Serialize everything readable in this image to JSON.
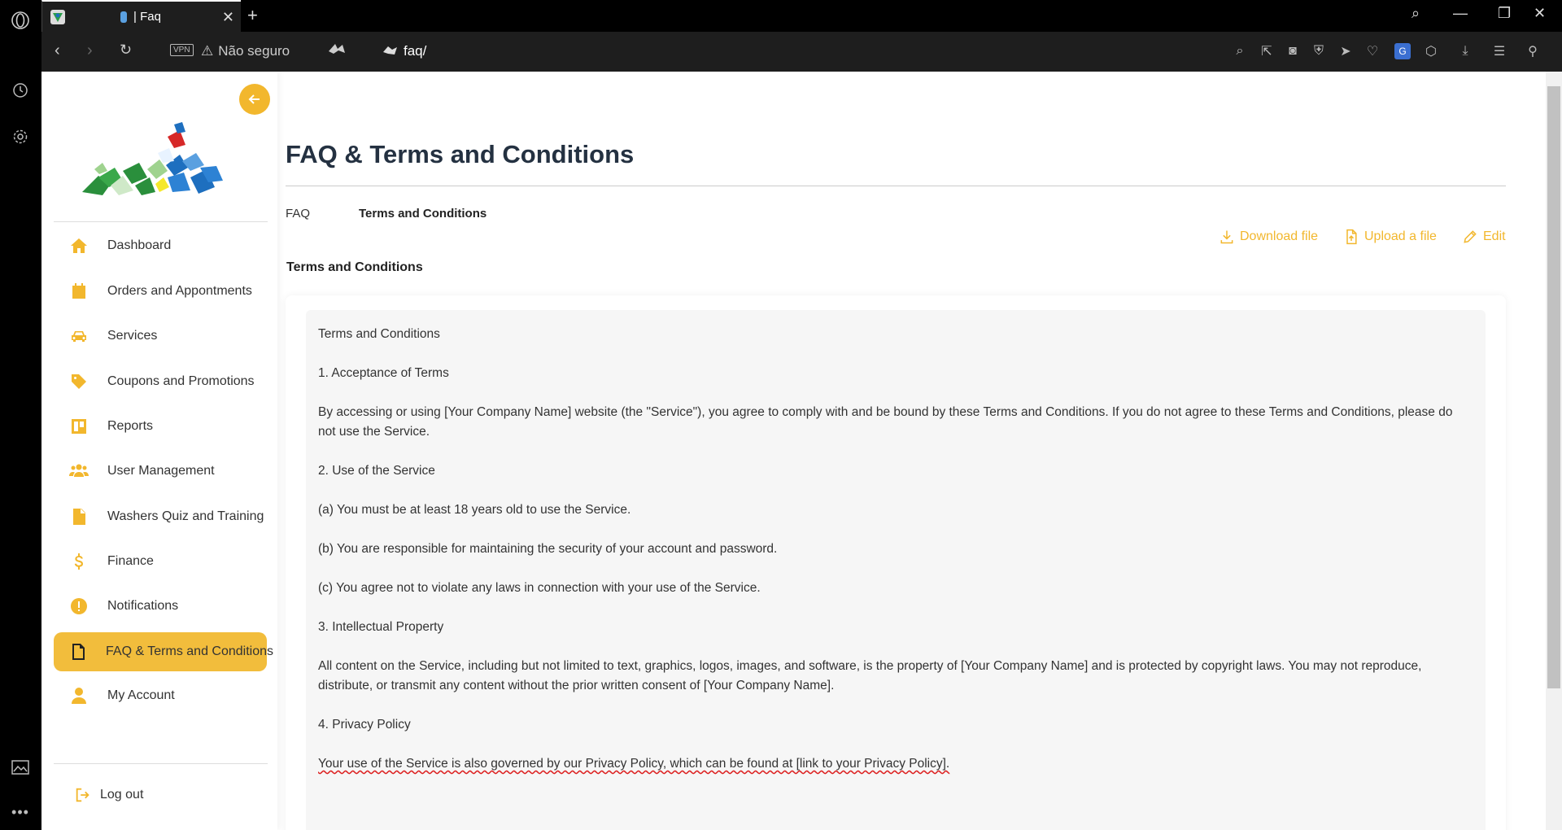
{
  "browser": {
    "tab_title": "| Faq",
    "insecure_label": "Não seguro",
    "vpn_label": "VPN",
    "url": "faq/"
  },
  "sidebar": {
    "items": [
      {
        "label": "Dashboard",
        "icon": "home-icon"
      },
      {
        "label": "Orders and Appontments",
        "icon": "calendar-icon"
      },
      {
        "label": "Services",
        "icon": "car-icon"
      },
      {
        "label": "Coupons and Promotions",
        "icon": "tag-icon"
      },
      {
        "label": "Reports",
        "icon": "reports-icon"
      },
      {
        "label": "User Management",
        "icon": "users-icon"
      },
      {
        "label": "Washers Quiz and Training",
        "icon": "document-icon"
      },
      {
        "label": "Finance",
        "icon": "dollar-icon"
      },
      {
        "label": "Notifications",
        "icon": "alert-icon"
      },
      {
        "label": "FAQ & Terms and Conditions",
        "icon": "file-icon",
        "active": true
      },
      {
        "label": "My Account",
        "icon": "user-icon"
      }
    ],
    "logout_label": "Log out"
  },
  "main": {
    "title": "FAQ & Terms and Conditions",
    "tabs": [
      {
        "label": "FAQ",
        "active": false
      },
      {
        "label": "Terms and Conditions",
        "active": true
      }
    ],
    "actions": {
      "download": "Download file",
      "upload": "Upload a file",
      "edit": "Edit"
    },
    "section_title": "Terms and Conditions",
    "content": {
      "heading": "Terms and Conditions",
      "s1_title": "1. Acceptance of Terms",
      "s1_body": "By accessing or using [Your Company Name] website (the \"Service\"), you agree to comply with and be bound by these Terms and Conditions. If you do not agree to these Terms and Conditions, please do not use the Service.",
      "s2_title": "2. Use of the Service",
      "s2_a": "(a) You must be at least 18 years old to use the Service.",
      "s2_b": "(b) You are responsible for maintaining the security of your account and password.",
      "s2_c": "(c) You agree not to violate any laws in connection with your use of the Service.",
      "s3_title": "3. Intellectual Property",
      "s3_body": "All content on the Service, including but not limited to text, graphics, logos, images, and software, is the property of [Your Company Name] and is protected by copyright laws. You may not reproduce, distribute, or transmit any content without the prior written consent of [Your Company Name].",
      "s4_title": "4. Privacy Policy",
      "s4_body": "Your use of the Service is also governed by our Privacy Policy, which can be found at [link to your Privacy Policy]."
    }
  },
  "colors": {
    "accent": "#f2b72d",
    "title": "#243141"
  }
}
